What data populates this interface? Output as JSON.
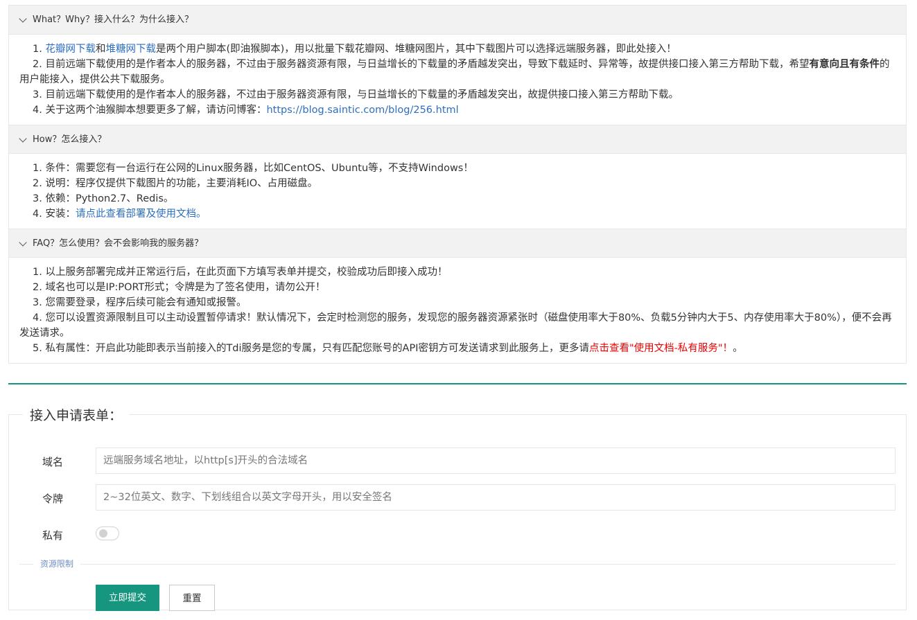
{
  "faq": [
    {
      "title": "What？Why？接入什么？为什么接入？",
      "items": [
        {
          "num": "1.",
          "segments": [
            {
              "text": "花瓣网下载",
              "type": "link"
            },
            {
              "text": "和",
              "type": "text"
            },
            {
              "text": "堆糖网下载",
              "type": "link"
            },
            {
              "text": "是两个用户脚本(即油猴脚本)，用以批量下载花瓣网、堆糖网图片，其中下载图片可以选择远端服务器，即此处接入！",
              "type": "text"
            }
          ]
        },
        {
          "num": "2.",
          "segments": [
            {
              "text": "目前远端下载使用的是作者本人的服务器，不过由于服务器资源有限，与日益增长的下载量的矛盾越发突出，导致下载延时、异常等，故提供接口接入第三方帮助下载，希望",
              "type": "text"
            },
            {
              "text": "有意向且有条件",
              "type": "bold"
            },
            {
              "text": "的用户能接入，提供公共下载服务。",
              "type": "text"
            }
          ]
        },
        {
          "num": "3.",
          "segments": [
            {
              "text": "目前远端下载使用的是作者本人的服务器，不过由于服务器资源有限，与日益增长的下载量的矛盾越发突出，故提供接口接入第三方帮助下载。",
              "type": "text"
            }
          ]
        },
        {
          "num": "4.",
          "segments": [
            {
              "text": "关于这两个油猴脚本想要更多了解，请访问博客：",
              "type": "text"
            },
            {
              "text": "https://blog.saintic.com/blog/256.html",
              "type": "link"
            }
          ]
        }
      ]
    },
    {
      "title": "How？怎么接入？",
      "items": [
        {
          "num": "1.",
          "segments": [
            {
              "text": "条件：需要您有一台运行在公网的Linux服务器，比如CentOS、Ubuntu等，不支持Windows！",
              "type": "text"
            }
          ]
        },
        {
          "num": "2.",
          "segments": [
            {
              "text": "说明：程序仅提供下载图片的功能，主要消耗IO、占用磁盘。",
              "type": "text"
            }
          ]
        },
        {
          "num": "3.",
          "segments": [
            {
              "text": "依赖：Python2.7、Redis。",
              "type": "text"
            }
          ]
        },
        {
          "num": "4.",
          "segments": [
            {
              "text": "安装：",
              "type": "text"
            },
            {
              "text": "请点此查看部署及使用文档。",
              "type": "link"
            }
          ]
        }
      ]
    },
    {
      "title": "FAQ？怎么使用？会不会影响我的服务器？",
      "items": [
        {
          "num": "1.",
          "segments": [
            {
              "text": "以上服务部署完成并正常运行后，在此页面下方填写表单并提交，校验成功后即接入成功！",
              "type": "text"
            }
          ]
        },
        {
          "num": "2.",
          "segments": [
            {
              "text": "域名也可以是IP:PORT形式；令牌是为了签名使用，请勿公开！",
              "type": "text"
            }
          ]
        },
        {
          "num": "3.",
          "segments": [
            {
              "text": "您需要登录，程序后续可能会有通知或报警。",
              "type": "text"
            }
          ]
        },
        {
          "num": "4.",
          "segments": [
            {
              "text": "您可以设置资源限制且可以主动设置暂停请求！默认情况下，会定时检测您的服务，发现您的服务器资源紧张时（磁盘使用率大于80%、负载5分钟内大于5、内存使用率大于80%），便不会再发送请求。",
              "type": "text"
            }
          ]
        },
        {
          "num": "5.",
          "segments": [
            {
              "text": "私有属性：开启此功能即表示当前接入的Tdi服务是您的专属，只有匹配您账号的API密钥方可发送请求到此服务上，更多请",
              "type": "text"
            },
            {
              "text": "点击查看\"使用文档-私有服务\"！",
              "type": "red"
            },
            {
              "text": "。",
              "type": "text"
            }
          ]
        }
      ]
    }
  ],
  "form": {
    "legend": "接入申请表单：",
    "domain_label": "域名",
    "domain_placeholder": "远端服务域名地址，以http[s]开头的合法域名",
    "token_label": "令牌",
    "token_placeholder": "2~32位英文、数字、下划线组合以英文字母开头，用以安全签名",
    "private_label": "私有",
    "private_on": false,
    "resource_limit_label": "资源限制",
    "submit_label": "立即提交",
    "reset_label": "重置"
  },
  "colors": {
    "accent": "#16967f",
    "link": "#2d6fc0",
    "warning": "#ee0000"
  }
}
